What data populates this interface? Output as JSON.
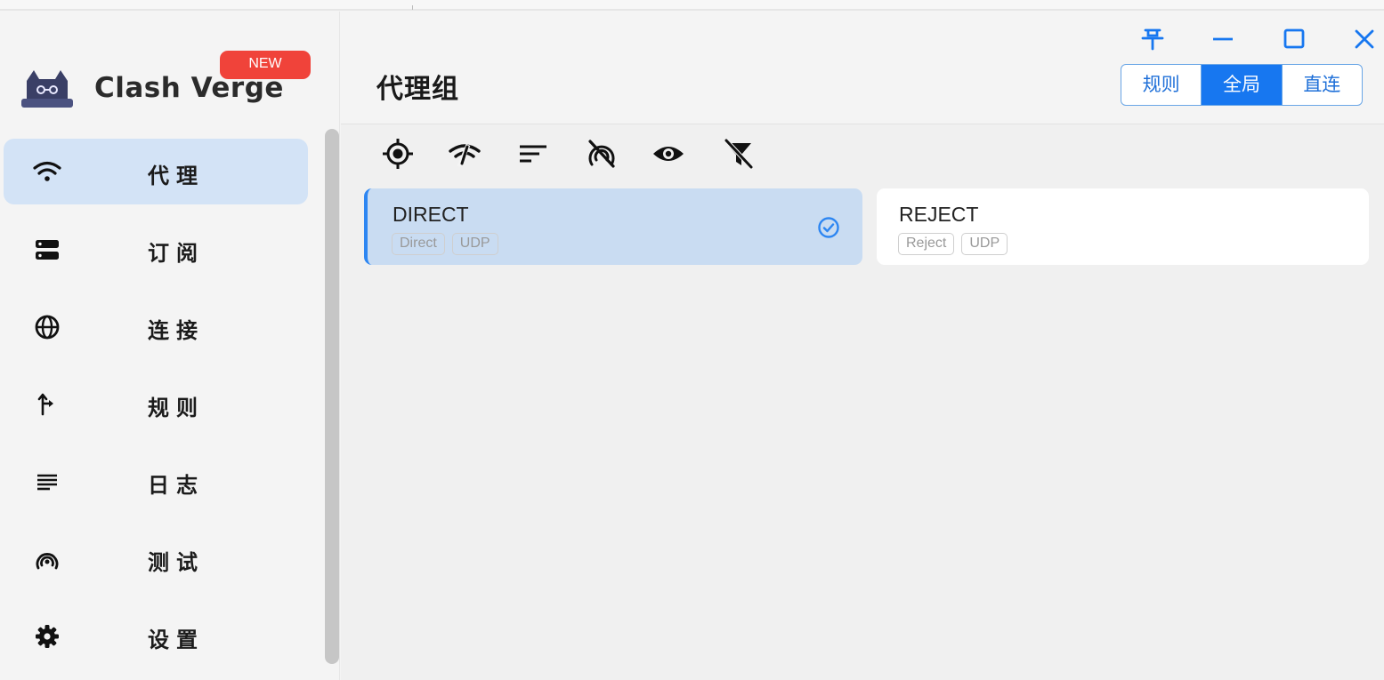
{
  "app": {
    "name": "Clash Verge",
    "badge": "NEW"
  },
  "sidebar": {
    "items": [
      {
        "label": "代理",
        "icon": "wifi-icon",
        "active": true
      },
      {
        "label": "订阅",
        "icon": "storage-icon",
        "active": false
      },
      {
        "label": "连接",
        "icon": "globe-icon",
        "active": false
      },
      {
        "label": "规则",
        "icon": "fork-arrow-icon",
        "active": false
      },
      {
        "label": "日志",
        "icon": "list-lines-icon",
        "active": false
      },
      {
        "label": "测试",
        "icon": "radar-icon",
        "active": false
      },
      {
        "label": "设置",
        "icon": "gear-icon",
        "active": false
      }
    ]
  },
  "header": {
    "title": "代理组",
    "window_controls": [
      "pin-icon",
      "minimize-icon",
      "maximize-icon",
      "close-icon"
    ],
    "modes": [
      {
        "label": "规则",
        "active": false
      },
      {
        "label": "全局",
        "active": true
      },
      {
        "label": "直连",
        "active": false
      }
    ]
  },
  "toolbar": {
    "icons": [
      "locate-icon",
      "delay-test-icon",
      "sort-icon",
      "hide-unavailable-icon",
      "show-icon",
      "filter-off-icon"
    ]
  },
  "proxies": [
    {
      "name": "DIRECT",
      "tags": [
        "Direct",
        "UDP"
      ],
      "selected": true
    },
    {
      "name": "REJECT",
      "tags": [
        "Reject",
        "UDP"
      ],
      "selected": false
    }
  ],
  "colors": {
    "accent": "#1777f0",
    "badge": "#f0433a",
    "selected_bg": "#c9dcf2",
    "active_nav_bg": "#d3e3f6"
  }
}
